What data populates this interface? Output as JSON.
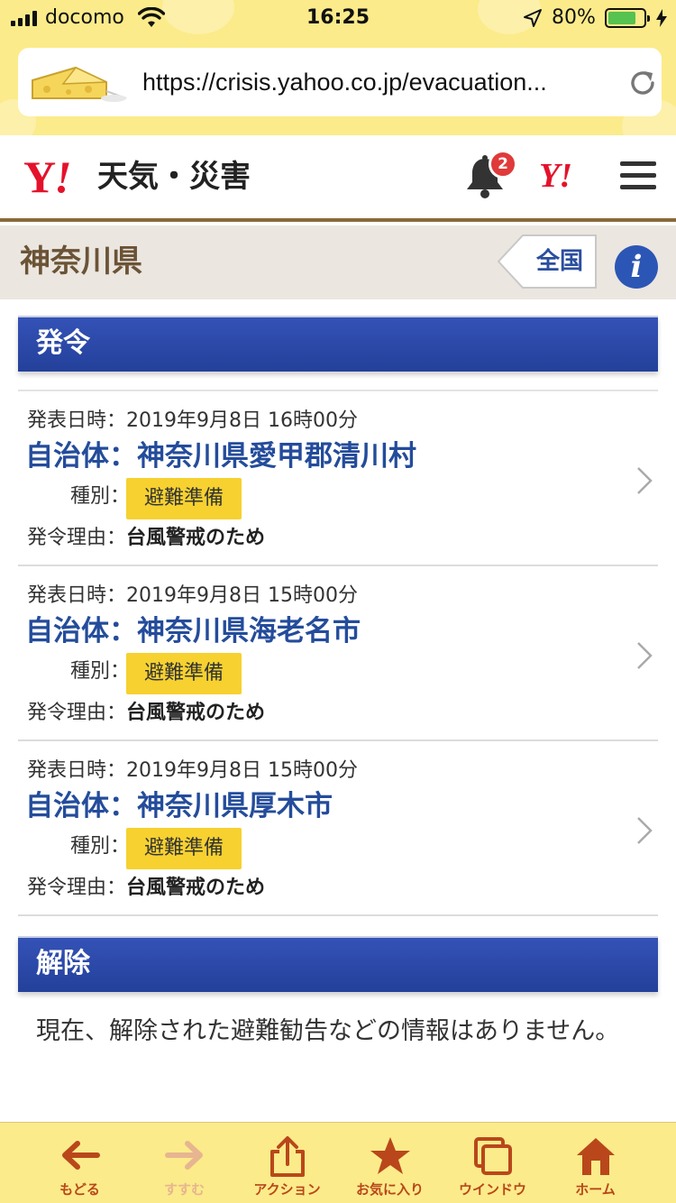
{
  "status_bar": {
    "carrier": "docomo",
    "time": "16:25",
    "battery": "80%",
    "battery_level": 0.8
  },
  "browser": {
    "url": "https://crisis.yahoo.co.jp/evacuation..."
  },
  "header": {
    "logo_text": "Y",
    "logo_mark": "!",
    "site_title": "天気・災害",
    "notification_count": "2",
    "yahoo_mini": "Y!"
  },
  "prefecture": {
    "name": "神奈川県",
    "nationwide_label": "全国",
    "info_glyph": "i"
  },
  "sections": {
    "issued": "発令",
    "released": "解除"
  },
  "items": [
    {
      "date": "発表日時：2019年9月8日 16時00分",
      "municipality": "自治体：神奈川県愛甲郡清川村",
      "type_label": "種別：",
      "type": "避難準備",
      "reason_label": "発令理由：",
      "reason": "台風警戒のため"
    },
    {
      "date": "発表日時：2019年9月8日 15時00分",
      "municipality": "自治体：神奈川県海老名市",
      "type_label": "種別：",
      "type": "避難準備",
      "reason_label": "発令理由：",
      "reason": "台風警戒のため"
    },
    {
      "date": "発表日時：2019年9月8日 15時00分",
      "municipality": "自治体：神奈川県厚木市",
      "type_label": "種別：",
      "type": "避難準備",
      "reason_label": "発令理由：",
      "reason": "台風警戒のため"
    }
  ],
  "release_message": "現在、解除された避難勧告などの情報はありません。",
  "toolbar": {
    "back": "もどる",
    "forward": "すすむ",
    "action": "アクション",
    "favorites": "お気に入り",
    "window": "ウインドウ",
    "home": "ホーム"
  },
  "colors": {
    "chrome_yellow": "#fbeb8a",
    "section_blue": "#2a47a8",
    "link_blue": "#244c9b",
    "badge_yellow": "#f6d130",
    "yahoo_red": "#e4122b",
    "toolbar_brown": "#b9471b"
  }
}
